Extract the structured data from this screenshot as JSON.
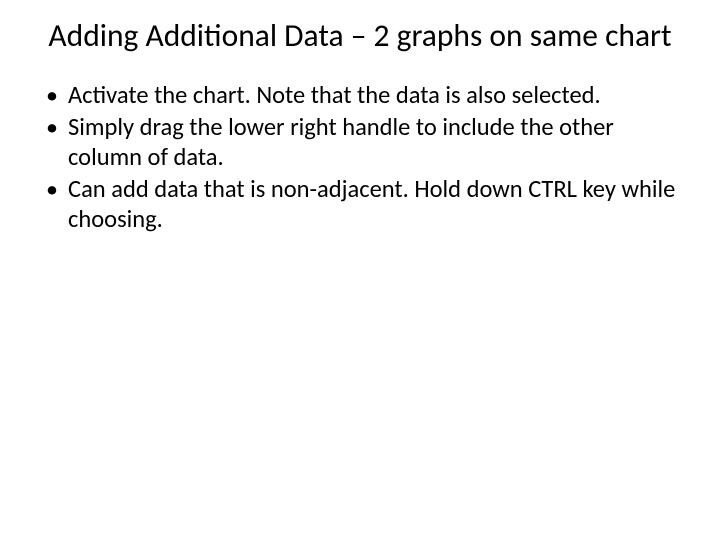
{
  "title": "Adding Additional Data – 2 graphs on same chart",
  "bullets": [
    "Activate the chart.  Note that the data is also selected.",
    "Simply drag the lower right handle to include the other column of data.",
    "Can add data that is non-adjacent. Hold down CTRL key while choosing."
  ]
}
